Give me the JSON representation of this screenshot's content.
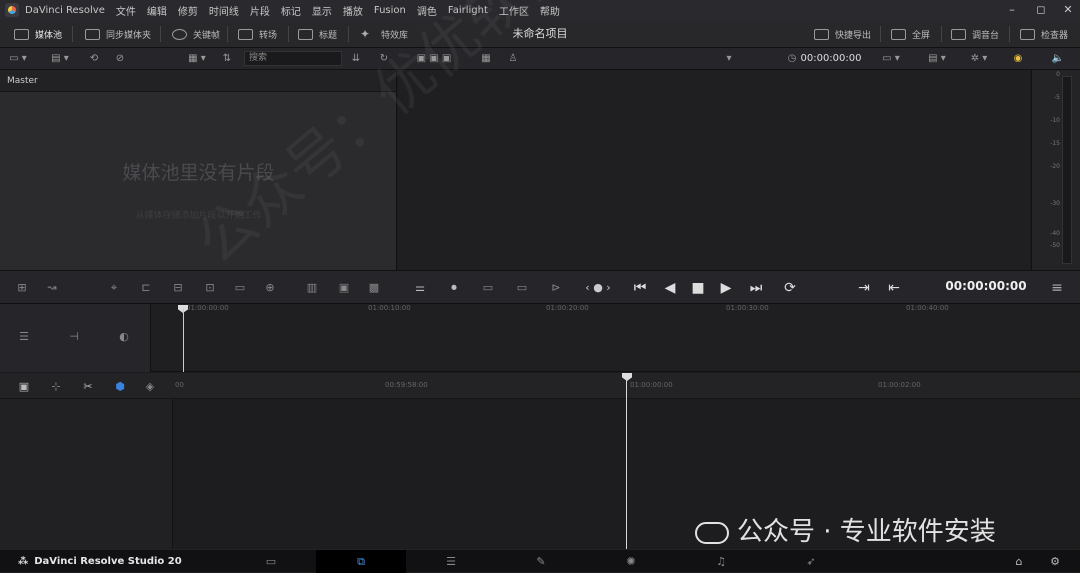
{
  "menubar": {
    "app_name": "DaVinci Resolve",
    "items": [
      "文件",
      "编辑",
      "修剪",
      "时间线",
      "片段",
      "标记",
      "显示",
      "播放",
      "Fusion",
      "调色",
      "Fairlight",
      "工作区",
      "帮助"
    ]
  },
  "toolbar": {
    "media_pool": "媒体池",
    "sync_bin": "同步媒体夹",
    "keyframes": "关键帧",
    "transitions": "转场",
    "titles": "标题",
    "effects": "特效库",
    "project_title": "未命名项目",
    "quick_export": "快捷导出",
    "fullscreen": "全屏",
    "mixer": "调音台",
    "inspector": "检查器"
  },
  "subbar": {
    "search_placeholder": "搜索",
    "source_timecode": "00:00:00:00"
  },
  "media_pool": {
    "bin_name": "Master",
    "empty_message": "媒体池里没有片段",
    "empty_hint": "从媒体存储添加片段以开始工作"
  },
  "meter": {
    "ticks": [
      "0",
      "-5",
      "-10",
      "-15",
      "-20",
      "-30",
      "-40",
      "-50"
    ]
  },
  "transport": {
    "timecode": "00:00:00:00"
  },
  "upper_ruler": [
    "01:00:00:00",
    "01:00:10:00",
    "01:00:20:00",
    "01:00:30:00",
    "01:00:40:00"
  ],
  "lower_ruler": [
    "00",
    "00:59:58:00",
    "01:00:00:00",
    "01:00:02:00"
  ],
  "pagebar": {
    "brand": "DaVinci Resolve Studio 20"
  },
  "watermark": {
    "diagonal": "公众号：优优软件安装",
    "corner": "公众号 · 专业软件安装"
  },
  "colors": {
    "accent": "#4a9ae8",
    "background": "#1c1c1f"
  }
}
